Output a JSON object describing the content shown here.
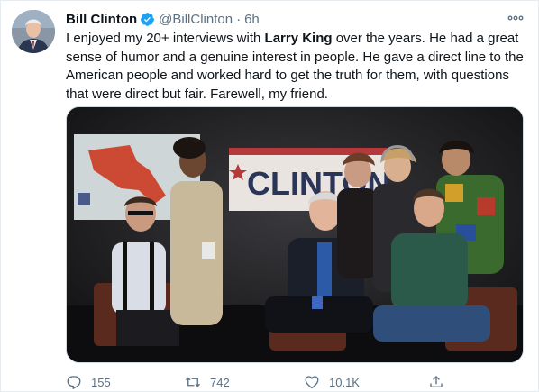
{
  "tweet": {
    "author_name": "Bill Clinton",
    "handle": "@BillClinton",
    "separator": "·",
    "time": "6h",
    "text_parts": [
      "I enjoyed my 20+ interviews with ",
      "Larry King",
      " over the years. He had a great sense of humor and a genuine interest in people. He gave a direct line to the American people and worked hard to get the truth for them, with questions that were direct but fair. Farewell, my friend."
    ],
    "media_sign_text": "CLINTON"
  },
  "actions": {
    "reply_count": "155",
    "retweet_count": "742",
    "like_count": "10.1K"
  },
  "icons": {
    "verified": "verified-badge-icon",
    "more": "more-icon",
    "reply": "reply-icon",
    "retweet": "retweet-icon",
    "like": "like-icon",
    "share": "share-icon"
  },
  "colors": {
    "text": "#0f1419",
    "secondary": "#5b7083",
    "verified": "#1da1f2",
    "border": "#e6ecf0"
  }
}
